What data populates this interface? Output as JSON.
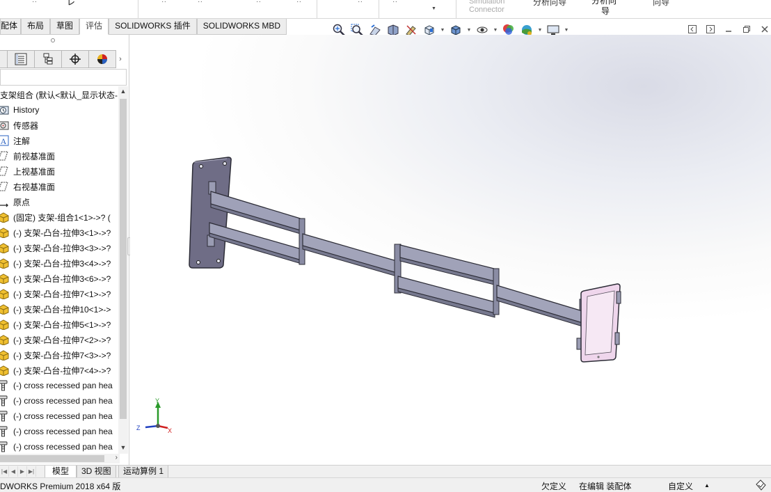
{
  "ribbon": {
    "fragments": [
      "ᆢ",
      "㆑",
      "ᆢ",
      "ᆢ",
      "ᆢ",
      "ᆢ"
    ],
    "simulation_connector_line1": "Simulation",
    "simulation_connector_line2": "Connector",
    "f1": "分析向导",
    "f2": "分析向",
    "f2b": "导",
    "f3": "向导"
  },
  "tabs": [
    "配体",
    "布局",
    "草图",
    "评估",
    "SOLIDWORKS 插件",
    "SOLIDWORKS MBD"
  ],
  "active_tab_index": 3,
  "tree": {
    "root": "支架组合  (默认<默认_显示状态-",
    "items": [
      {
        "icon": "history-icon",
        "label": "History"
      },
      {
        "icon": "sensor-icon",
        "label": "传感器"
      },
      {
        "icon": "annotation-icon",
        "label": "注解"
      },
      {
        "icon": "plane-icon",
        "label": "前视基准面"
      },
      {
        "icon": "plane-icon",
        "label": "上视基准面"
      },
      {
        "icon": "plane-icon",
        "label": "右视基准面"
      },
      {
        "icon": "origin-icon",
        "label": "原点"
      },
      {
        "icon": "part-icon",
        "label": "(固定) 支架-组合1<1>->? ("
      },
      {
        "icon": "part-icon",
        "label": "(-) 支架-凸台-拉伸3<1>->?"
      },
      {
        "icon": "part-icon",
        "label": "(-) 支架-凸台-拉伸3<3>->?"
      },
      {
        "icon": "part-icon",
        "label": "(-) 支架-凸台-拉伸3<4>->?"
      },
      {
        "icon": "part-icon",
        "label": "(-) 支架-凸台-拉伸3<6>->?"
      },
      {
        "icon": "part-icon",
        "label": "(-) 支架-凸台-拉伸7<1>->?"
      },
      {
        "icon": "part-icon",
        "label": "(-) 支架-凸台-拉伸10<1>->"
      },
      {
        "icon": "part-icon",
        "label": "(-) 支架-凸台-拉伸5<1>->?"
      },
      {
        "icon": "part-icon",
        "label": "(-) 支架-凸台-拉伸7<2>->?"
      },
      {
        "icon": "part-icon",
        "label": "(-) 支架-凸台-拉伸7<3>->?"
      },
      {
        "icon": "part-icon",
        "label": "(-) 支架-凸台-拉伸7<4>->?"
      },
      {
        "icon": "screw-icon",
        "label": "(-) cross recessed pan hea"
      },
      {
        "icon": "screw-icon",
        "label": "(-) cross recessed pan hea"
      },
      {
        "icon": "screw-icon",
        "label": "(-) cross recessed pan hea"
      },
      {
        "icon": "screw-icon",
        "label": "(-) cross recessed pan hea"
      },
      {
        "icon": "screw-icon",
        "label": "(-) cross recessed pan hea"
      }
    ]
  },
  "triad": {
    "y": "Y",
    "z": "Z",
    "x": "X"
  },
  "bottom_tabs": [
    "模型",
    "3D 视图",
    "运动算例 1"
  ],
  "active_bottom_tab": 0,
  "status": {
    "product": "DWORKS Premium 2018 x64 版",
    "underdefined": "欠定义",
    "editing": "在编辑 装配体",
    "custom": "自定义",
    "caret": "▲"
  },
  "colors": {
    "part_fill": "#9a9cb3",
    "part_edge": "#3c3c48",
    "tablet_fill": "#efd6ec",
    "triad_x": "#d02020",
    "triad_y": "#2a9a2a",
    "triad_z": "#2040c0"
  }
}
